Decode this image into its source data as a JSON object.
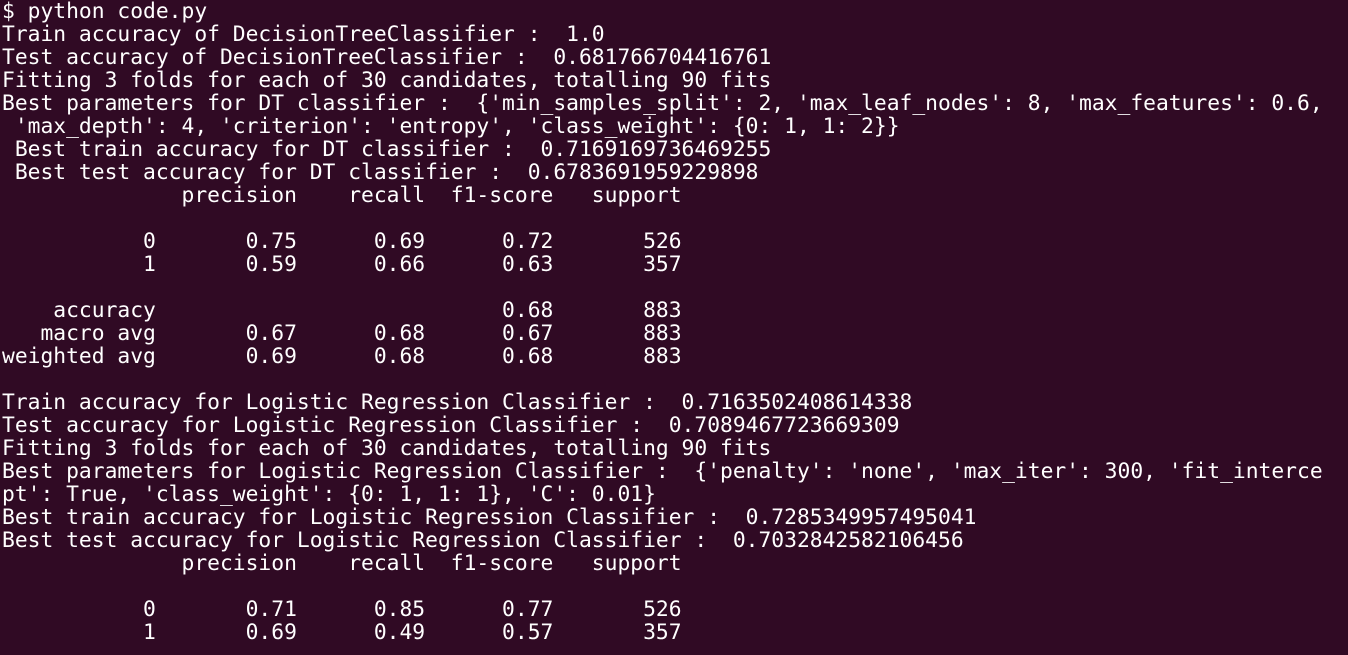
{
  "terminal": {
    "lines": [
      "$ python code.py",
      "Train accuracy of DecisionTreeClassifier :  1.0",
      "Test accuracy of DecisionTreeClassifier :  0.681766704416761",
      "Fitting 3 folds for each of 30 candidates, totalling 90 fits",
      "Best parameters for DT classifier :  {'min_samples_split': 2, 'max_leaf_nodes': 8, 'max_features': 0.6,",
      " 'max_depth': 4, 'criterion': 'entropy', 'class_weight': {0: 1, 1: 2}}",
      " Best train accuracy for DT classifier :  0.7169169736469255",
      " Best test accuracy for DT classifier :  0.6783691959229898",
      "              precision    recall  f1-score   support",
      "",
      "           0       0.75      0.69      0.72       526",
      "           1       0.59      0.66      0.63       357",
      "",
      "    accuracy                           0.68       883",
      "   macro avg       0.67      0.68      0.67       883",
      "weighted avg       0.69      0.68      0.68       883",
      "",
      "Train accuracy for Logistic Regression Classifier :  0.7163502408614338",
      "Test accuracy for Logistic Regression Classifier :  0.7089467723669309",
      "Fitting 3 folds for each of 30 candidates, totalling 90 fits",
      "Best parameters for Logistic Regression Classifier :  {'penalty': 'none', 'max_iter': 300, 'fit_interce",
      "pt': True, 'class_weight': {0: 1, 1: 1}, 'C': 0.01}",
      "Best train accuracy for Logistic Regression Classifier :  0.7285349957495041",
      "Best test accuracy for Logistic Regression Classifier :  0.7032842582106456",
      "              precision    recall  f1-score   support",
      "",
      "           0       0.71      0.85      0.77       526",
      "           1       0.69      0.49      0.57       357"
    ]
  }
}
